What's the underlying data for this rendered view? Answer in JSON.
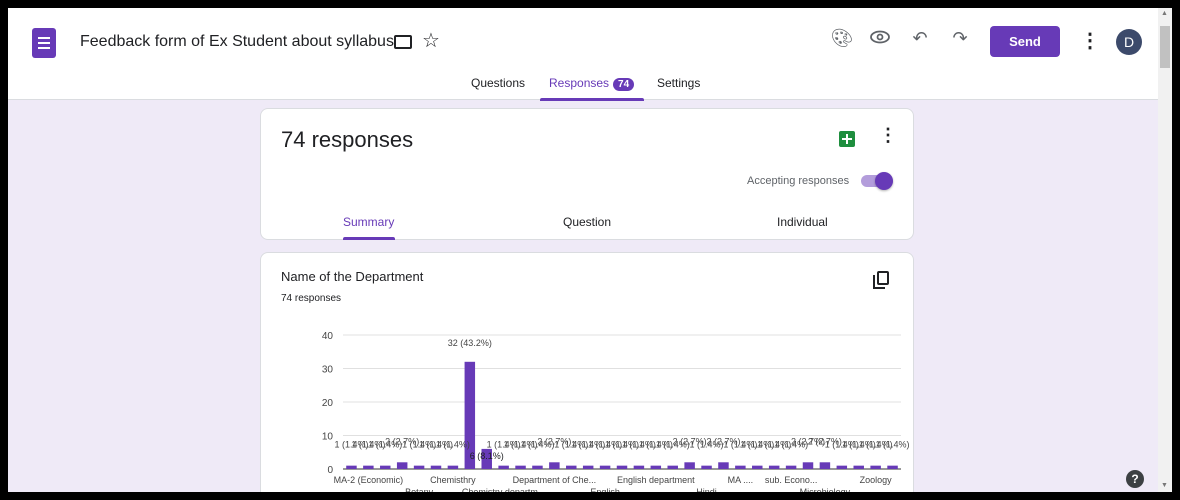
{
  "header": {
    "title": "Feedback form of Ex Student about syllabus",
    "send_label": "Send",
    "avatar_initial": "D"
  },
  "tabs": [
    {
      "label": "Questions"
    },
    {
      "label": "Responses",
      "badge": "74"
    },
    {
      "label": "Settings"
    }
  ],
  "summary_card": {
    "count_label": "74 responses",
    "accepting_label": "Accepting responses",
    "accepting_on": true,
    "subtabs": [
      {
        "label": "Summary"
      },
      {
        "label": "Question"
      },
      {
        "label": "Individual"
      }
    ]
  },
  "question_card": {
    "title": "Name of the Department",
    "subtitle": "74 responses"
  },
  "colors": {
    "accent": "#673ab7",
    "background": "#efeaf7"
  },
  "chart_data": {
    "type": "bar",
    "title": "",
    "xlabel": "",
    "ylabel": "",
    "ylim": [
      0,
      40
    ],
    "yticks": [
      0,
      10,
      20,
      30,
      40
    ],
    "bar_color": "#673ab7",
    "grid": true,
    "values": [
      1,
      1,
      1,
      2,
      1,
      1,
      1,
      32,
      6,
      1,
      1,
      1,
      2,
      1,
      1,
      1,
      1,
      1,
      1,
      1,
      2,
      1,
      2,
      1,
      1,
      1,
      1,
      2,
      2,
      1,
      1,
      1,
      1
    ],
    "value_labels": [
      "1 (1.4%)",
      "1 (1.4%)",
      "1 (1.4%)",
      "2 (2.7%)",
      "1 (1.4%)",
      "1 (1.4%)",
      "1 (1.4%)",
      "32 (43.2%)",
      "6 (8.1%)",
      "1 (1.4%)",
      "1 (1.4%)",
      "1 (1.4%)",
      "2 (2.7%)",
      "1 (1.4%)",
      "1 (1.4%)",
      "1 (1.4%)",
      "1 (1.4%)",
      "1 (1.4%)",
      "1 (1.4%)",
      "1 (1.4%)",
      "2 (2.7%)",
      "1 (1.4%)",
      "2 (2.7%)",
      "1 (1.4%)",
      "1 (1.4%)",
      "1 (1.4%)",
      "1 (1.4%)",
      "2 (2.7%)",
      "2 (2.7%)",
      "1 (1.4%)",
      "1 (1.4%)",
      "1 (1.4%)",
      "1 (1.4%)"
    ],
    "x_labels": [
      {
        "text": "MA-2 (Economic)",
        "at": 1,
        "row": 0
      },
      {
        "text": "Botany",
        "at": 4,
        "row": 1
      },
      {
        "text": "Chemisthry",
        "at": 6,
        "row": 0
      },
      {
        "text": "Chemistry departm...",
        "at": 9,
        "row": 1
      },
      {
        "text": "Department of Che...",
        "at": 12,
        "row": 0
      },
      {
        "text": "English",
        "at": 15,
        "row": 1
      },
      {
        "text": "English department",
        "at": 18,
        "row": 0
      },
      {
        "text": "Hindi",
        "at": 21,
        "row": 1
      },
      {
        "text": "MA ....",
        "at": 23,
        "row": 0
      },
      {
        "text": "sub. Econo...",
        "at": 26,
        "row": 0
      },
      {
        "text": "Microbiology",
        "at": 28,
        "row": 1
      },
      {
        "text": "Zoology",
        "at": 31,
        "row": 0
      }
    ]
  }
}
